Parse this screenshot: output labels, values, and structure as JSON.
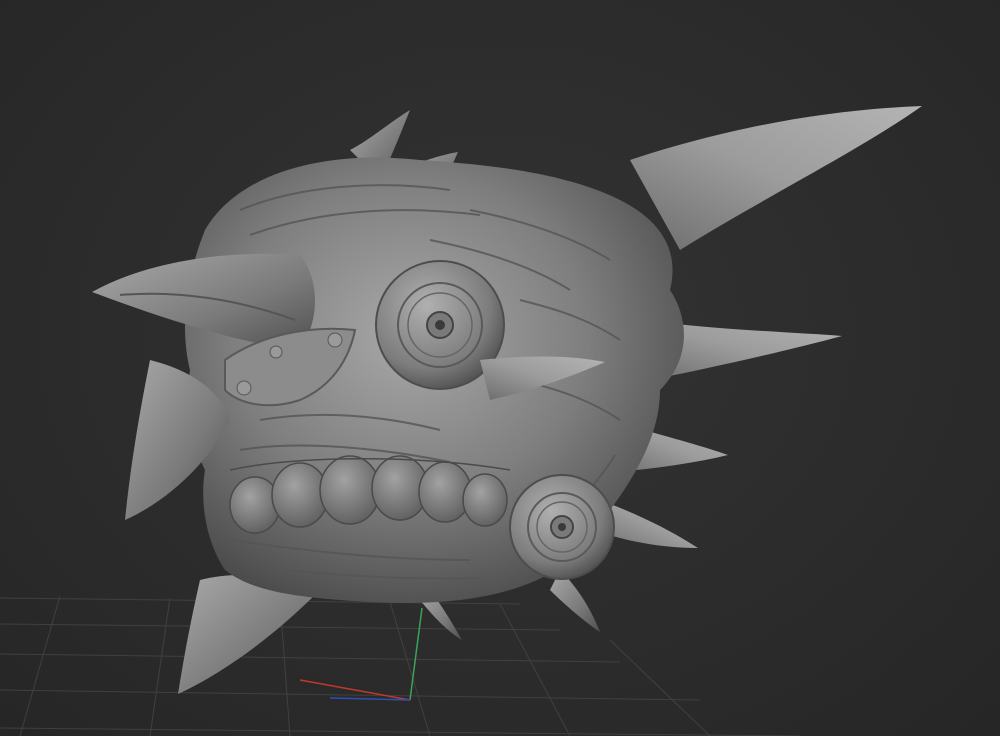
{
  "viewport": {
    "background": "#2b2b2b",
    "model": "sculpted-creature-head",
    "material_color": "#8a8a8a",
    "floor_grid": true,
    "axis_colors": {
      "x": "#c0392b",
      "y": "#3aa35a",
      "z": "#2f4fb0"
    }
  }
}
